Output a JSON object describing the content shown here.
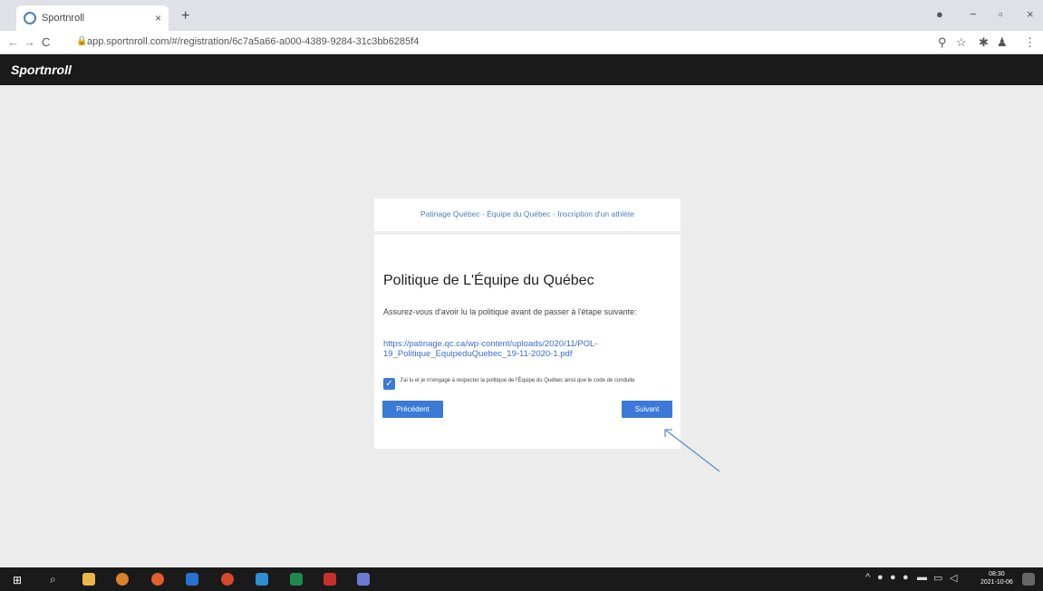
{
  "browser": {
    "tab_title": "Sportnroll",
    "tab_close": "×",
    "new_tab": "+",
    "url": "app.sportnroll.com/#/registration/6c7a5a66-a000-4389-9284-31c3bb6285f4",
    "win_minimize": "−",
    "win_restore": "▫",
    "win_close": "×"
  },
  "app": {
    "logo": "Sportnroll"
  },
  "card_top": {
    "breadcrumb": "Patinage Québec - Équipe du Québec - Inscription d'un athlète"
  },
  "card_main": {
    "title": "Politique de L'Équipe du Québec",
    "description": "Assurez-vous d'avoir lu la politique avant de passer à l'étape suivante:",
    "link": "https://patinage.qc.ca/wp-content/uploads/2020/11/POL-19_Politique_EquipeduQuebec_19-11-2020-1.pdf",
    "checkbox_label": "J'ai lu et je m'engage à respecter la politique de l'Équipe du Québec ainsi que le code de conduite",
    "checkbox_checked": true,
    "prev_button": "Précédent",
    "next_button": "Suivant"
  },
  "taskbar": {
    "time": "08:30",
    "date": "2021-10-06"
  },
  "colors": {
    "accent": "#3b7ad9",
    "header": "#1a1a1a",
    "page_bg": "#ececec"
  }
}
